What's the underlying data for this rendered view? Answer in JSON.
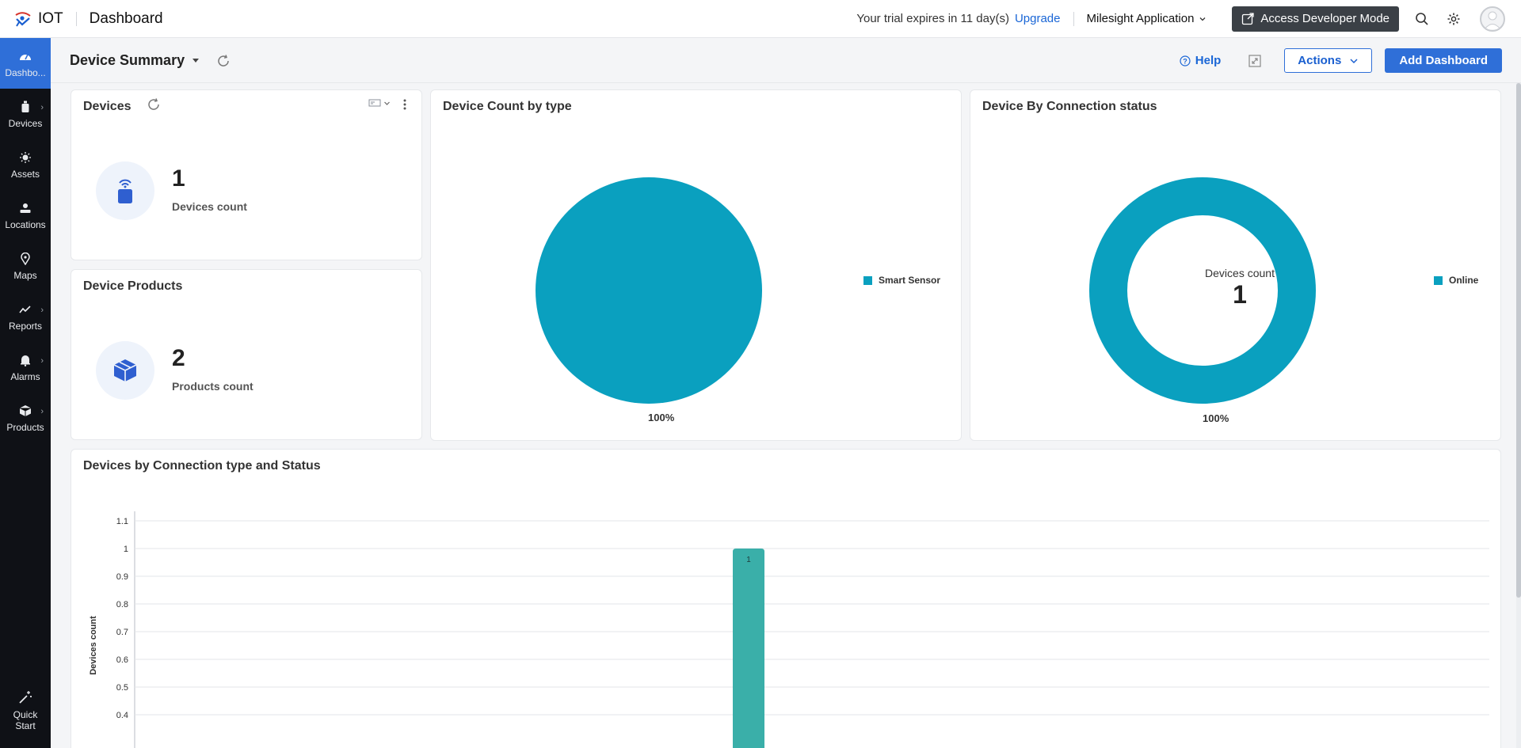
{
  "topbar": {
    "brand": "IOT",
    "page": "Dashboard",
    "trial_text": "Your trial expires in 11 day(s)",
    "upgrade_label": "Upgrade",
    "app_name": "Milesight Application",
    "dev_mode_label": "Access Developer Mode"
  },
  "sidebar": {
    "items": [
      {
        "label": "Dashbo...",
        "icon": "dashboard-icon",
        "active": true
      },
      {
        "label": "Devices",
        "icon": "device-icon"
      },
      {
        "label": "Assets",
        "icon": "asset-icon"
      },
      {
        "label": "Locations",
        "icon": "location-icon"
      },
      {
        "label": "Maps",
        "icon": "map-pin-icon"
      },
      {
        "label": "Reports",
        "icon": "reports-icon"
      },
      {
        "label": "Alarms",
        "icon": "bell-icon"
      },
      {
        "label": "Products",
        "icon": "box-icon"
      }
    ],
    "quick_start": [
      "Quick",
      "Start"
    ]
  },
  "subheader": {
    "title": "Device Summary",
    "help_label": "Help",
    "actions_label": "Actions",
    "add_dashboard_label": "Add Dashboard"
  },
  "widgets": {
    "devices": {
      "title": "Devices",
      "value": "1",
      "label": "Devices count"
    },
    "products": {
      "title": "Device Products",
      "value": "2",
      "label": "Products count"
    },
    "count_by_type": {
      "title": "Device Count by type",
      "legend": "Smart Sensor",
      "pct": "100%"
    },
    "connection_status": {
      "title": "Device By Connection status",
      "center_label": "Devices count",
      "center_value": "1",
      "legend": "Online",
      "pct": "100%"
    },
    "conn_type_status": {
      "title": "Devices by Connection type and Status"
    }
  },
  "colors": {
    "accent": "#2f6fd8",
    "pie": "#0aa0bf",
    "bar": "#3aafa9"
  },
  "chart_data": [
    {
      "type": "pie",
      "title": "Device Count by type",
      "labels": [
        "Smart Sensor"
      ],
      "values": [
        100
      ],
      "value_labels": [
        "100%"
      ],
      "legend": "right"
    },
    {
      "type": "pie",
      "title": "Device By Connection status",
      "donut": true,
      "center_label": "Devices count",
      "center_value": 1,
      "labels": [
        "Online"
      ],
      "values": [
        100
      ],
      "value_labels": [
        "100%"
      ],
      "legend": "right"
    },
    {
      "type": "bar",
      "title": "Devices by Connection type and Status",
      "ylabel": "Devices count",
      "yticks": [
        "1.1",
        "1",
        "0.9",
        "0.8",
        "0.7",
        "0.6",
        "0.5",
        "0.4"
      ],
      "ylim": [
        0.4,
        1.1
      ],
      "series": [
        {
          "values": [
            1
          ],
          "data_labels": [
            "1"
          ]
        }
      ],
      "grid": true
    }
  ]
}
